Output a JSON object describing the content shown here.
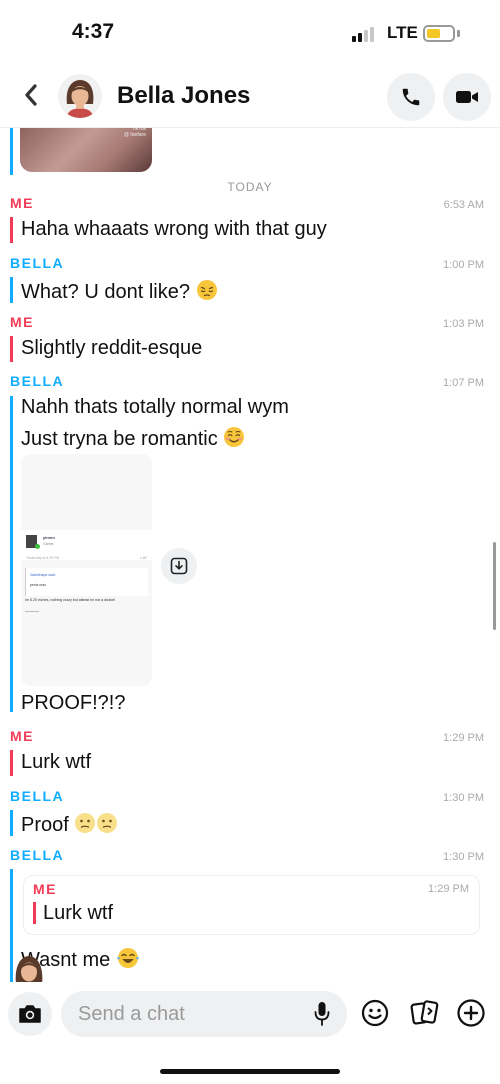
{
  "status_bar": {
    "time": "4:37",
    "network": "LTE",
    "signal_bars": 2,
    "battery_level": 0.45,
    "battery_color": "#f4c623"
  },
  "header": {
    "back_icon": "chevron-left-icon",
    "contact_name": "Bella Jones",
    "call_icon": "phone-icon",
    "video_icon": "video-camera-icon"
  },
  "colors": {
    "me": "#f23c57",
    "bella": "#0eadff"
  },
  "divider": {
    "label": "TODAY"
  },
  "messages": [
    {
      "sender": "ME",
      "time": "6:53 AM",
      "text": "Haha whaaats wrong with that guy"
    },
    {
      "sender": "BELLA",
      "time": "1:00 PM",
      "text": "What? U dont like?",
      "emoji": "pensive-face"
    },
    {
      "sender": "ME",
      "time": "1:03 PM",
      "text": "Slightly reddit-esque"
    },
    {
      "sender": "BELLA",
      "time": "1:07 PM",
      "lines": [
        "Nahh thats totally normal wym",
        "Just tryna be romantic"
      ],
      "emoji": "smiling-face",
      "attachment": {
        "type": "screenshot",
        "post_user": "ylrven",
        "post_role": "Gamer",
        "post_meta": "Yesterday at 6:28 PM",
        "post_share": "< #7",
        "quote_author": "Valvethapa said:",
        "quote_text": "penis max",
        "reply_text": "Im 6.25 inches, nothing crazy but atleast im not a dickcel"
      },
      "caption": "PROOF!?!?"
    },
    {
      "sender": "ME",
      "time": "1:29 PM",
      "text": "Lurk wtf"
    },
    {
      "sender": "BELLA",
      "time": "1:30 PM",
      "text": "Proof",
      "emoji": "hushed-face x2"
    },
    {
      "sender": "BELLA",
      "time": "1:30 PM",
      "reply_to": {
        "sender": "ME",
        "time": "1:29 PM",
        "text": "Lurk wtf"
      },
      "text": "Wasnt me",
      "emoji": "tears-of-joy-face"
    }
  ],
  "composer": {
    "placeholder": "Send a chat",
    "camera_icon": "camera-icon",
    "mic_icon": "microphone-icon",
    "sticker_icon": "sticker-smile-icon",
    "cards_icon": "cards-icon",
    "plus_icon": "plus-circle-icon"
  }
}
